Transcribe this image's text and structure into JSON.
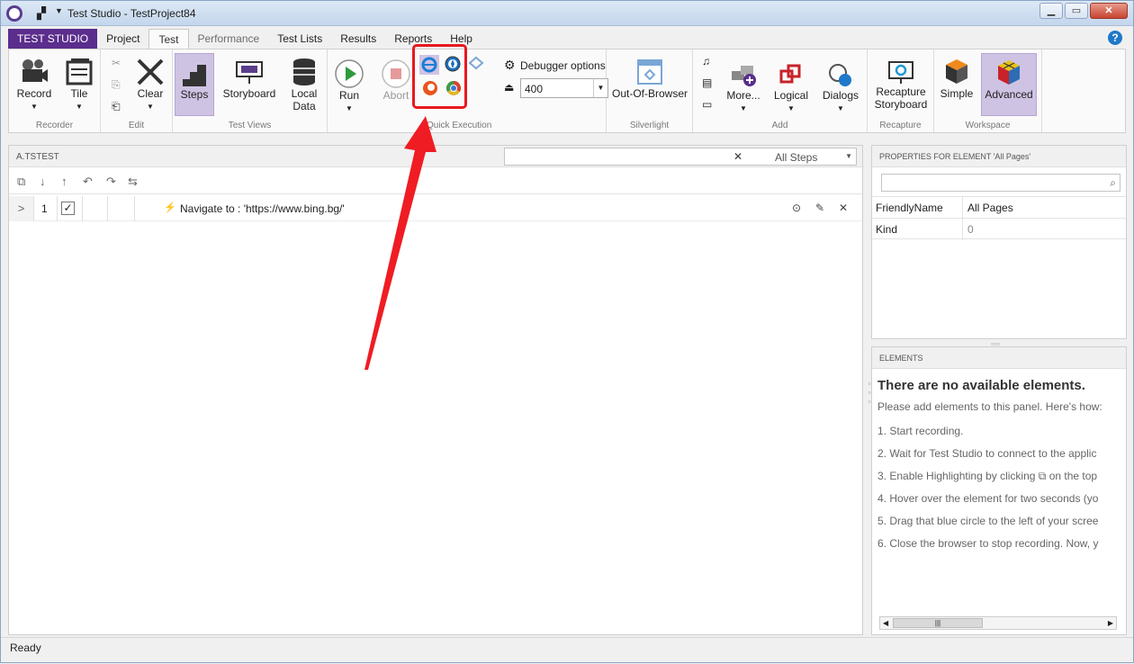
{
  "window": {
    "title": "Test Studio - TestProject84"
  },
  "tabs": [
    {
      "label": "TEST STUDIO"
    },
    {
      "label": "Project"
    },
    {
      "label": "Test"
    },
    {
      "label": "Performance"
    },
    {
      "label": "Test Lists"
    },
    {
      "label": "Results"
    },
    {
      "label": "Reports"
    },
    {
      "label": "Help"
    }
  ],
  "ribbon": {
    "recorder": {
      "record": "Record",
      "label": "Recorder"
    },
    "tile": "Tile",
    "edit": {
      "clear": "Clear",
      "label": "Edit"
    },
    "views": {
      "steps": "Steps",
      "storyboard": "Storyboard",
      "local_data_1": "Local",
      "local_data_2": "Data",
      "label": "Test Views"
    },
    "execution": {
      "run": "Run",
      "abort": "Abort",
      "label": "Quick Execution",
      "debugger": "Debugger options",
      "delay": "400"
    },
    "silverlight": {
      "oob": "Out-Of-Browser",
      "label": "Silverlight"
    },
    "add": {
      "more": "More...",
      "logical": "Logical",
      "dialogs": "Dialogs",
      "label": "Add"
    },
    "recapture": {
      "btn_1": "Recapture",
      "btn_2": "Storyboard",
      "label": "Recapture"
    },
    "workspace": {
      "simple": "Simple",
      "advanced": "Advanced",
      "label": "Workspace"
    }
  },
  "test_panel": {
    "name": "A.TSTEST",
    "filter_value": "All Steps",
    "steps": [
      {
        "number": "1",
        "text": "Navigate to : 'https://www.bing.bg/'"
      }
    ]
  },
  "properties": {
    "header": "PROPERTIES FOR ELEMENT 'All Pages'",
    "rows": [
      {
        "key": "FriendlyName",
        "value": "All Pages"
      },
      {
        "key": "Kind",
        "value": "0"
      }
    ]
  },
  "elements": {
    "header": "ELEMENTS",
    "title": "There are no available elements.",
    "intro": "Please add elements to this panel. Here's how:",
    "steps": [
      "1. Start recording.",
      "2. Wait for Test Studio to connect to the applic",
      "3. Enable Highlighting by clicking",
      "on the top",
      "4. Hover over the element for two seconds (yo",
      "5. Drag that blue circle to the left of your scree",
      "6. Close the browser to stop recording. Now, y"
    ]
  },
  "status": {
    "text": "Ready"
  },
  "colors": {
    "brand": "#5b2d8c",
    "highlight": "#e8181f",
    "selected": "#cfc3e3"
  }
}
